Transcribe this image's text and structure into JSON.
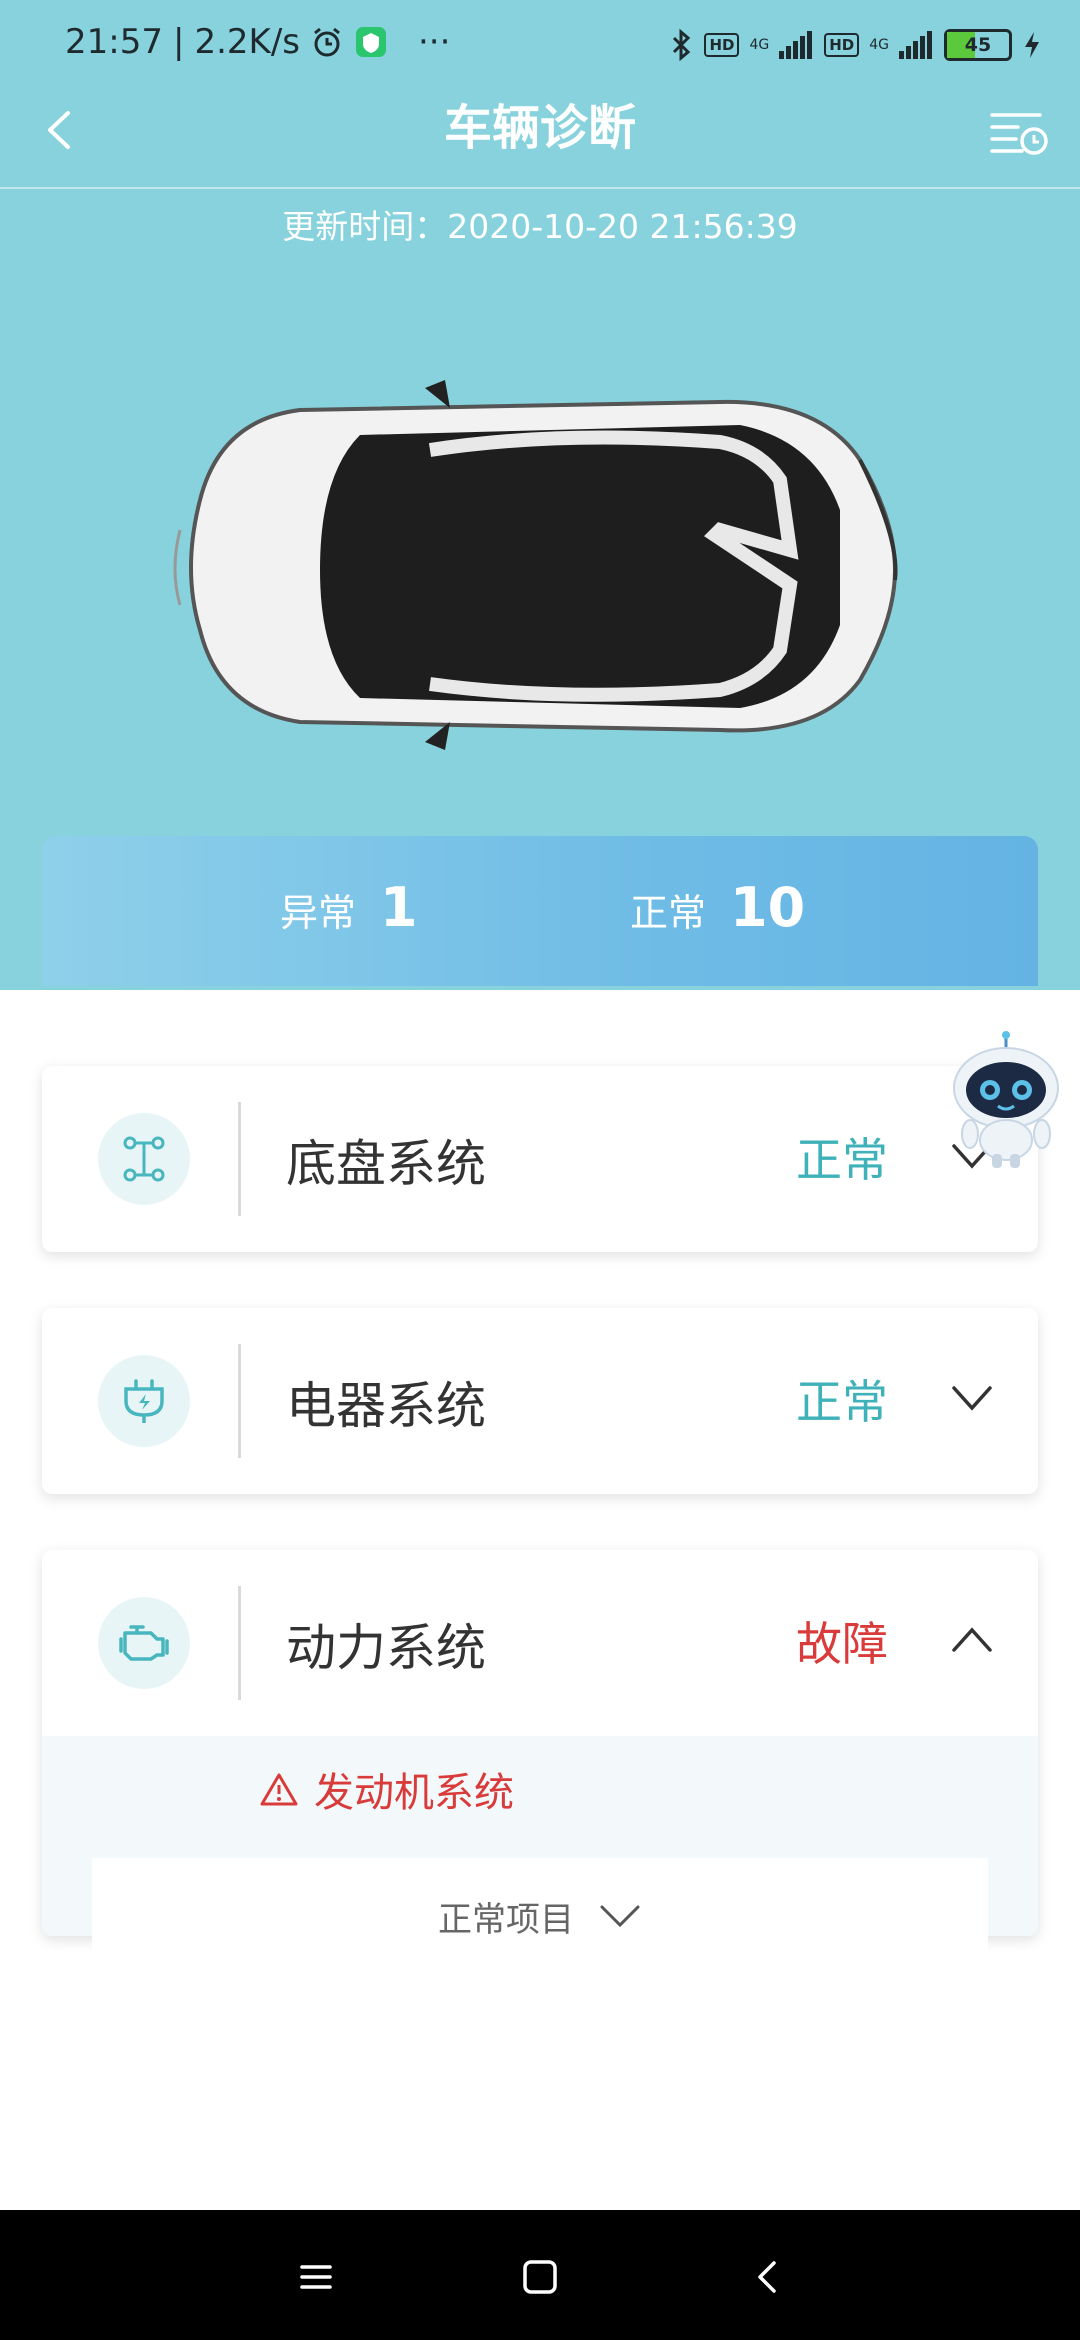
{
  "status_bar": {
    "time": "21:57",
    "speed": "2.2K/s",
    "more": "···",
    "net1": "4G",
    "net2": "4G",
    "hd": "HD",
    "battery": "45",
    "battery_level_percent": 45
  },
  "nav": {
    "title": "车辆诊断"
  },
  "update_time": "更新时间：2020-10-20 21:56:39",
  "summary": {
    "abnormal_label": "异常",
    "abnormal_count": "1",
    "normal_label": "正常",
    "normal_count": "10"
  },
  "systems": [
    {
      "name": "底盘系统",
      "status": "正常",
      "icon": "chassis-icon",
      "expanded": false
    },
    {
      "name": "电器系统",
      "status": "正常",
      "icon": "electrical-plug-icon",
      "expanded": false
    },
    {
      "name": "动力系统",
      "status": "故障",
      "icon": "engine-icon",
      "expanded": true,
      "fault_item": "发动机系统",
      "normal_items_label": "正常项目"
    }
  ],
  "colors": {
    "header_bg": "#87d2dc",
    "ok": "#3fb1b8",
    "fault": "#d93b3b"
  }
}
